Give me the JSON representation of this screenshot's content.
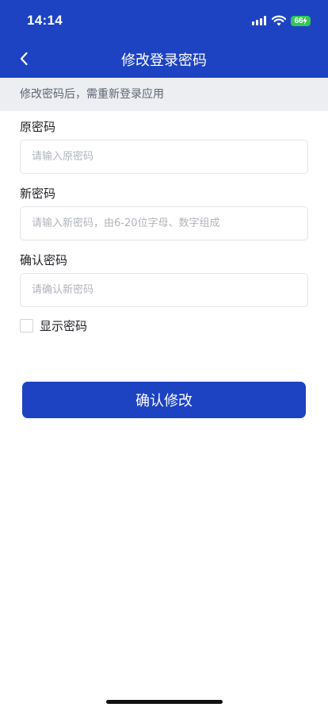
{
  "status_bar": {
    "time": "14:14",
    "battery": "66"
  },
  "nav": {
    "title": "修改登录密码",
    "back_icon": "chevron-left-icon"
  },
  "notice": "修改密码后，需重新登录应用",
  "form": {
    "old_password": {
      "label": "原密码",
      "placeholder": "请输入原密码",
      "value": ""
    },
    "new_password": {
      "label": "新密码",
      "placeholder": "请输入新密码，由6-20位字母、数字组成",
      "value": ""
    },
    "confirm_password": {
      "label": "确认密码",
      "placeholder": "请确认新密码",
      "value": ""
    },
    "show_password": {
      "label": "显示密码",
      "checked": false
    }
  },
  "confirm_button": "确认修改",
  "colors": {
    "primary": "#1d43c2",
    "notice_bg": "#eceef1",
    "battery": "#33c759"
  }
}
